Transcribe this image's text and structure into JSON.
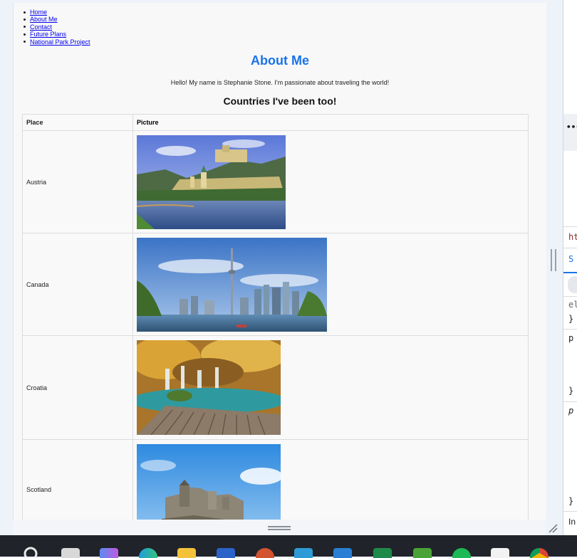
{
  "nav": {
    "items": [
      "Home",
      "About Me",
      "Contact",
      "Future Plans",
      "National Park Project"
    ]
  },
  "page": {
    "title": "About Me",
    "intro": "Hello! My name is Stephanie Stone. I'm passionate about traveling the world!",
    "subtitle": "Countries I've been too!"
  },
  "table": {
    "headers": {
      "place": "Place",
      "picture": "Picture"
    },
    "rows": [
      {
        "place": "Austria",
        "image": "austria-castle-river-photo"
      },
      {
        "place": "Canada",
        "image": "toronto-skyline-cn-tower-photo"
      },
      {
        "place": "Croatia",
        "image": "waterfall-lake-boardwalk-photo"
      },
      {
        "place": "Scotland",
        "image": "scottish-castle-photo"
      }
    ]
  },
  "devtools": {
    "texts": [
      "ht",
      "S",
      "el",
      "}",
      "p",
      "}",
      "p",
      "}",
      "In"
    ],
    "menu_icon": "more-dots-icon"
  },
  "taskbar": {
    "icons": [
      "search-icon",
      "task-view-icon",
      "copilot-icon",
      "edge-icon",
      "file-explorer-icon",
      "word-icon",
      "powerpoint-icon",
      "app-icon",
      "vscode-icon",
      "excel-icon",
      "minecraft-icon",
      "spotify-icon",
      "calendar-icon",
      "chrome-icon"
    ]
  },
  "colors": {
    "title": "#1a73e8",
    "link": "#0000ee",
    "taskbar": "#20242a"
  }
}
